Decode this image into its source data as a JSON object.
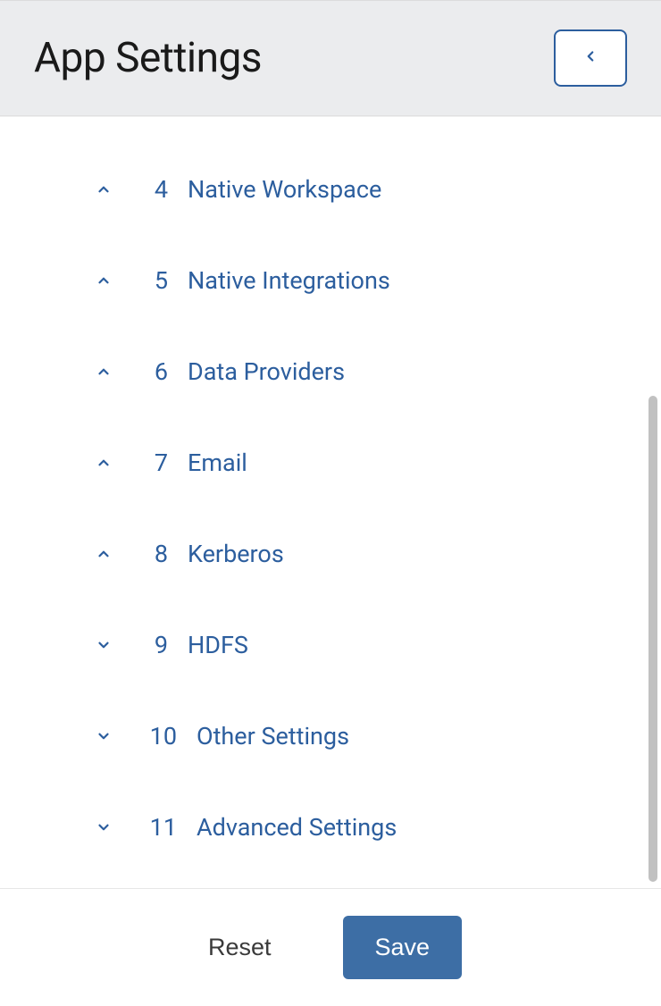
{
  "header": {
    "title": "App Settings"
  },
  "sections": [
    {
      "number": "4",
      "label": "Native Workspace",
      "expanded": false,
      "chevron": "up"
    },
    {
      "number": "5",
      "label": "Native Integrations",
      "expanded": false,
      "chevron": "up"
    },
    {
      "number": "6",
      "label": "Data Providers",
      "expanded": false,
      "chevron": "up"
    },
    {
      "number": "7",
      "label": "Email",
      "expanded": false,
      "chevron": "up"
    },
    {
      "number": "8",
      "label": "Kerberos",
      "expanded": false,
      "chevron": "up"
    },
    {
      "number": "9",
      "label": "HDFS",
      "expanded": true,
      "chevron": "down"
    },
    {
      "number": "10",
      "label": "Other Settings",
      "expanded": true,
      "chevron": "down"
    },
    {
      "number": "11",
      "label": "Advanced Settings",
      "expanded": true,
      "chevron": "down"
    }
  ],
  "footer": {
    "reset_label": "Reset",
    "save_label": "Save"
  }
}
